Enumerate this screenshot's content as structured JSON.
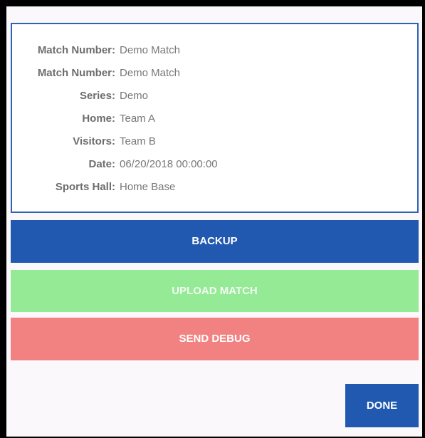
{
  "match_info": {
    "rows": [
      {
        "key": "Match Number:",
        "value": "Demo Match"
      },
      {
        "key": "Match Number:",
        "value": "Demo Match"
      },
      {
        "key": "Series:",
        "value": "Demo"
      },
      {
        "key": "Home:",
        "value": "Team A"
      },
      {
        "key": "Visitors:",
        "value": "Team B"
      },
      {
        "key": "Date:",
        "value": "06/20/2018 00:00:00"
      },
      {
        "key": "Sports Hall:",
        "value": "Home Base"
      }
    ]
  },
  "actions": {
    "backup_label": "BACKUP",
    "upload_label": "UPLOAD MATCH",
    "debug_label": "SEND DEBUG",
    "done_label": "DONE"
  },
  "colors": {
    "primary_blue": "#2159b0",
    "upload_green": "#95ea95",
    "debug_red": "#f28282",
    "card_border": "#2c63b5"
  }
}
